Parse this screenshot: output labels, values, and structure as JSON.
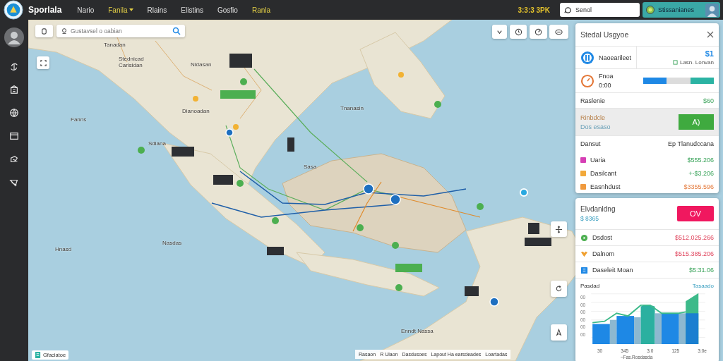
{
  "app": {
    "title": "Sporlala"
  },
  "nav": [
    {
      "label": "Nario",
      "accent": false,
      "menu": false
    },
    {
      "label": "Fanila",
      "accent": true,
      "menu": true
    },
    {
      "label": "Rlains",
      "accent": false,
      "menu": false
    },
    {
      "label": "Elistins",
      "accent": false,
      "menu": false
    },
    {
      "label": "Gosfio",
      "accent": false,
      "menu": false
    },
    {
      "label": "Ranla",
      "accent": true,
      "menu": false
    }
  ],
  "clock": "3:3:3 3PK",
  "search": {
    "placeholder": "Senol"
  },
  "user": {
    "name": "Stissanianes"
  },
  "map": {
    "search_placeholder": "Gustavsel o oabian",
    "labels": [
      "Tanadan",
      "Stednicad Carisidan",
      "Nidasan",
      "Dianoadan",
      "Fanns",
      "Sdiana",
      "Sasa",
      "Tnanasin",
      "Nasdas",
      "Hnasd",
      "Enndt Nassa"
    ],
    "legend": "Gfaciatoe",
    "attribution": [
      "Rasaon",
      "R Ulaon",
      "Dasdusoes",
      "Lapout Ha earsdeades",
      "Loartadas"
    ]
  },
  "summary_panel": {
    "title": "Stedal Usgyoe",
    "top": {
      "label": "Naoearileet",
      "value": "$1",
      "sub": "Lasn. Lonvan"
    },
    "timer": {
      "label": "Fnoa",
      "sub": "0:00",
      "segments": [
        {
          "color": "#1e88e5"
        },
        {
          "color": "#dcdcdc"
        },
        {
          "color": "#2bb3a3"
        }
      ]
    },
    "balance": {
      "label": "Raslenie",
      "value": "$60"
    },
    "action": {
      "label": "Rinbdcle",
      "sub": "Dos esaso",
      "button": "A)"
    },
    "header_row": {
      "label": "Dansut",
      "value": "Ep Tlanudccana"
    },
    "items": [
      {
        "label": "Uaria",
        "value": "$555.206",
        "color": "#d63fb5",
        "kind": "gain"
      },
      {
        "label": "Dasilcant",
        "value": "+-$3.206",
        "color": "#f2a93b",
        "kind": "gain"
      },
      {
        "label": "Easnhdust",
        "value": "$3355.596",
        "color": "#f09a3e",
        "kind": "cost"
      }
    ]
  },
  "finance_panel": {
    "title": "Elvdanldng",
    "sub": "$ 8365",
    "button": "OV",
    "rows": [
      {
        "label": "Dsdost",
        "value": "$512.025.266",
        "color": "#4caf50",
        "kind": "loss"
      },
      {
        "label": "Dalnom",
        "value": "$515.385.206",
        "color": "#f0a030",
        "kind": "loss"
      },
      {
        "label": "Daseleit Moan",
        "value": "$5:31.06",
        "color": "#1e88e5",
        "kind": "gain"
      }
    ],
    "chart": {
      "title": "Pasdad",
      "link": "Tasaado",
      "y_ticks": [
        "00",
        "00",
        "00",
        "00",
        "00",
        "00"
      ],
      "x_ticks": [
        "30",
        "345",
        "3:0",
        "125",
        "3:0e"
      ],
      "xlabel": "~Fas.Rosdasda"
    }
  }
}
